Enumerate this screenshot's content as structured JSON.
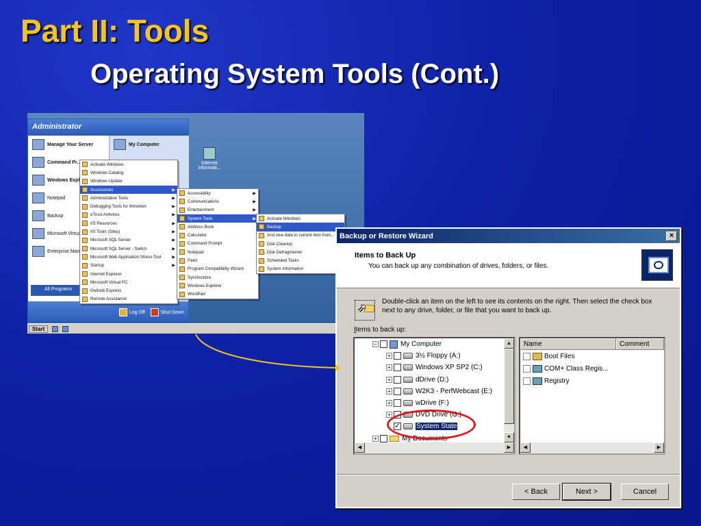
{
  "slide": {
    "title": "Part II:  Tools",
    "subtitle": "Operating System Tools (Cont.)"
  },
  "start_menu": {
    "user": "Administrator",
    "pinned_left": [
      "Manage Your Server",
      "Command Pr...",
      "Windows Expl...",
      "Notepad",
      "Backup",
      "Microsoft Virtual...",
      "Enterprise Man..."
    ],
    "pinned_right": [
      "My Computer"
    ],
    "all_programs": "All Programs",
    "log_off": "Log Off",
    "shut_down": "Shut Down",
    "taskbar_start": "Start",
    "desktop_icon": "Internet Informati..."
  },
  "programs_menu": [
    "Activate Windows",
    "Windows Catalog",
    "Windows Update",
    "Accessories",
    "Administrative Tools",
    "Debugging Tools for Windows",
    "eTrust Antivirus",
    "IIS Resources",
    "IIS Tools (Sites)",
    "Microsoft SQL Server",
    "Microsoft SQL Server - Switch",
    "Microsoft Web Application Stress Tool",
    "Startup",
    "Internet Explorer",
    "Microsoft Virtual PC",
    "Outlook Express",
    "Remote Assistance"
  ],
  "accessories_menu": [
    "Accessibility",
    "Communications",
    "Entertainment",
    "System Tools",
    "Address Book",
    "Calculator",
    "Command Prompt",
    "Notepad",
    "Paint",
    "Program Compatibility Wizard",
    "Synchronize",
    "Windows Explorer",
    "WordPad"
  ],
  "system_tools_menu": [
    "Activate Windows",
    "Backup",
    "And new data to current item from...",
    "Disk Cleanup",
    "Disk Defragmenter",
    "Scheduled Tasks",
    "System Information"
  ],
  "wizard": {
    "title": "Backup or Restore Wizard",
    "close_glyph": "×",
    "header_title": "Items to Back Up",
    "header_desc": "You can back up any combination of drives, folders, or files.",
    "instructions": "Double-click an item on the left to see its contents on the right. Then select the check box next to any drive, folder, or file that you want to back up.",
    "items_label_underlined": "I",
    "items_label_rest": "tems to back up:",
    "tree": [
      {
        "label": "My Computer",
        "expander": "−",
        "checked": false,
        "icon": "computer-icon",
        "indent": 0
      },
      {
        "label": "3½ Floppy (A:)",
        "expander": "+",
        "checked": false,
        "icon": "floppy-drive-icon",
        "indent": 1
      },
      {
        "label": "Windows XP SP2 (C:)",
        "expander": "+",
        "checked": false,
        "icon": "hard-drive-icon",
        "indent": 1
      },
      {
        "label": "dDrive (D:)",
        "expander": "+",
        "checked": false,
        "icon": "hard-drive-icon",
        "indent": 1
      },
      {
        "label": "W2K3 - PerfWebcast (E:)",
        "expander": "+",
        "checked": false,
        "icon": "hard-drive-icon",
        "indent": 1
      },
      {
        "label": "wDrive (F:)",
        "expander": "+",
        "checked": false,
        "icon": "hard-drive-icon",
        "indent": 1
      },
      {
        "label": "DVD Drive (G:)",
        "expander": "+",
        "checked": false,
        "icon": "dvd-drive-icon",
        "indent": 1
      },
      {
        "label": "System State",
        "expander": "",
        "checked": true,
        "icon": "system-state-icon",
        "indent": 1
      },
      {
        "label": "My Documents",
        "expander": "+",
        "checked": false,
        "icon": "folder-icon",
        "indent": 0
      }
    ],
    "list_columns": [
      "Name",
      "Comment"
    ],
    "list_rows": [
      {
        "name": "Boot Files",
        "comment": ""
      },
      {
        "name": "COM+ Class Regis...",
        "comment": ""
      },
      {
        "name": "Registry",
        "comment": ""
      }
    ],
    "buttons": {
      "back": "< Back",
      "next": "Next >",
      "cancel": "Cancel"
    }
  },
  "colors": {
    "background": "#0b1fa6",
    "title": "#f7c51a",
    "callout_arrow": "#f5c518",
    "highlight_ellipse": "#e1141c",
    "selection": "#0a246a"
  }
}
